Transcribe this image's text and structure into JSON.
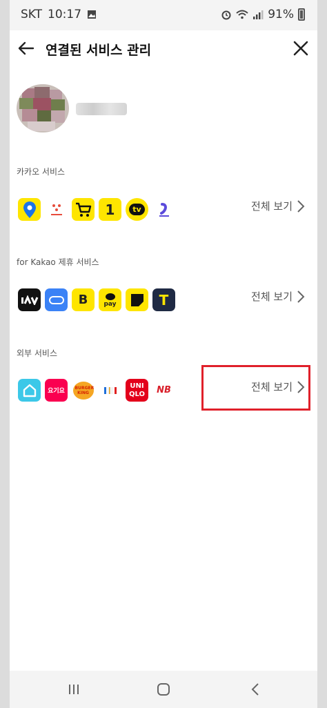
{
  "status": {
    "carrier": "SKT",
    "time": "10:17",
    "battery": "91%"
  },
  "header": {
    "title": "연결된 서비스 관리"
  },
  "sections": [
    {
      "label": "카카오 서비스",
      "view_all": "전체 보기"
    },
    {
      "label": "for Kakao 제휴 서비스",
      "view_all": "전체 보기"
    },
    {
      "label": "외부 서비스",
      "view_all": "전체 보기"
    }
  ],
  "icons": {
    "kakao": [
      "kakaomap-icon",
      "kakaot-icon",
      "kakao-shopping-icon",
      "kakao-one-icon",
      "kakao-tv-icon",
      "kakao-quote-icon"
    ],
    "partner": [
      "ziv-icon",
      "car-pill-icon",
      "brand-b-icon",
      "kakaopay-icon",
      "flag-icon",
      "kakaot-blue-icon"
    ],
    "external": [
      "home-icon",
      "yogiyo-icon",
      "burgerking-icon",
      "barcode-icon",
      "uniqlo-icon",
      "newbalance-icon"
    ]
  },
  "icon_text": {
    "one": "1",
    "tv": "tv",
    "b": "B",
    "pay": "pay",
    "t": "T",
    "yogiyo": "요기요",
    "uni": "UNI",
    "qlo": "QLO",
    "nb": "NB",
    "bk": "BURGER KING"
  },
  "colors": {
    "kakao_yellow": "#FEE500",
    "highlight": "#E0202A"
  }
}
